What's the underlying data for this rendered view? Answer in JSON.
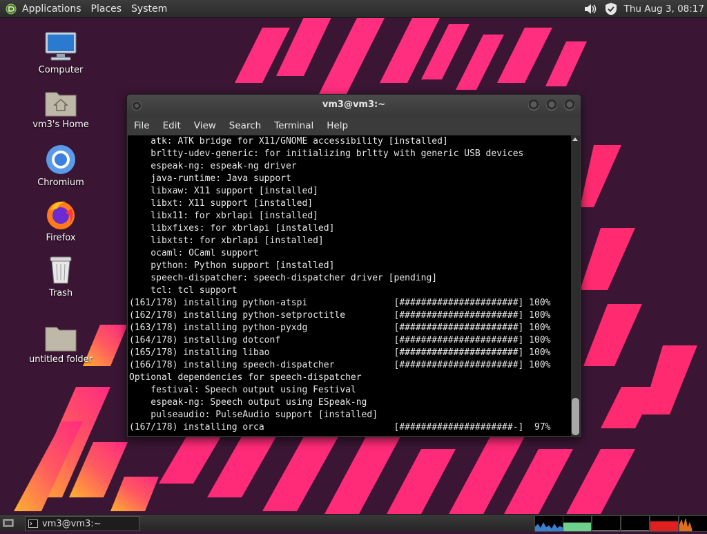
{
  "top_panel": {
    "menus": [
      "Applications",
      "Places",
      "System"
    ],
    "clock": "Thu Aug  3, 08:17",
    "tray_icons": [
      "volume-icon",
      "shield-icon"
    ]
  },
  "desktop": {
    "icons": [
      {
        "label": "Computer",
        "icon": "computer-icon"
      },
      {
        "label": "vm3's Home",
        "icon": "home-folder-icon"
      },
      {
        "label": "Chromium",
        "icon": "chromium-icon"
      },
      {
        "label": "Firefox",
        "icon": "firefox-icon"
      },
      {
        "label": "Trash",
        "icon": "trash-icon"
      },
      {
        "label": "untitled folder",
        "icon": "folder-icon"
      }
    ]
  },
  "terminal": {
    "title": "vm3@vm3:~",
    "menus": [
      "File",
      "Edit",
      "View",
      "Search",
      "Terminal",
      "Help"
    ],
    "lines": [
      "    atk: ATK bridge for X11/GNOME accessibility [installed]",
      "    brltty-udev-generic: for initializing brltty with generic USB devices",
      "    espeak-ng: espeak-ng driver",
      "    java-runtime: Java support",
      "    libxaw: X11 support [installed]",
      "    libxt: X11 support [installed]",
      "    libx11: for xbrlapi [installed]",
      "    libxfixes: for xbrlapi [installed]",
      "    libxtst: for xbrlapi [installed]",
      "    ocaml: OCaml support",
      "    python: Python support [installed]",
      "    speech-dispatcher: speech-dispatcher driver [pending]",
      "    tcl: tcl support",
      "(161/178) installing python-atspi                [######################] 100%",
      "(162/178) installing python-setproctitle         [######################] 100%",
      "(163/178) installing python-pyxdg                [######################] 100%",
      "(164/178) installing dotconf                     [######################] 100%",
      "(165/178) installing libao                       [######################] 100%",
      "(166/178) installing speech-dispatcher           [######################] 100%",
      "Optional dependencies for speech-dispatcher",
      "    festival: Speech output using Festival",
      "    espeak-ng: Speech output using ESpeak-ng",
      "    pulseaudio: PulseAudio support [installed]",
      "(167/178) installing orca                        [#####################-]  97%"
    ]
  },
  "taskbar": {
    "task_label": "vm3@vm3:~",
    "monitor_colors": [
      "#3a7fd0",
      "#6fd08c",
      "#d0d0d0",
      "#d0d0d0",
      "#e02020",
      "#e07020"
    ]
  }
}
